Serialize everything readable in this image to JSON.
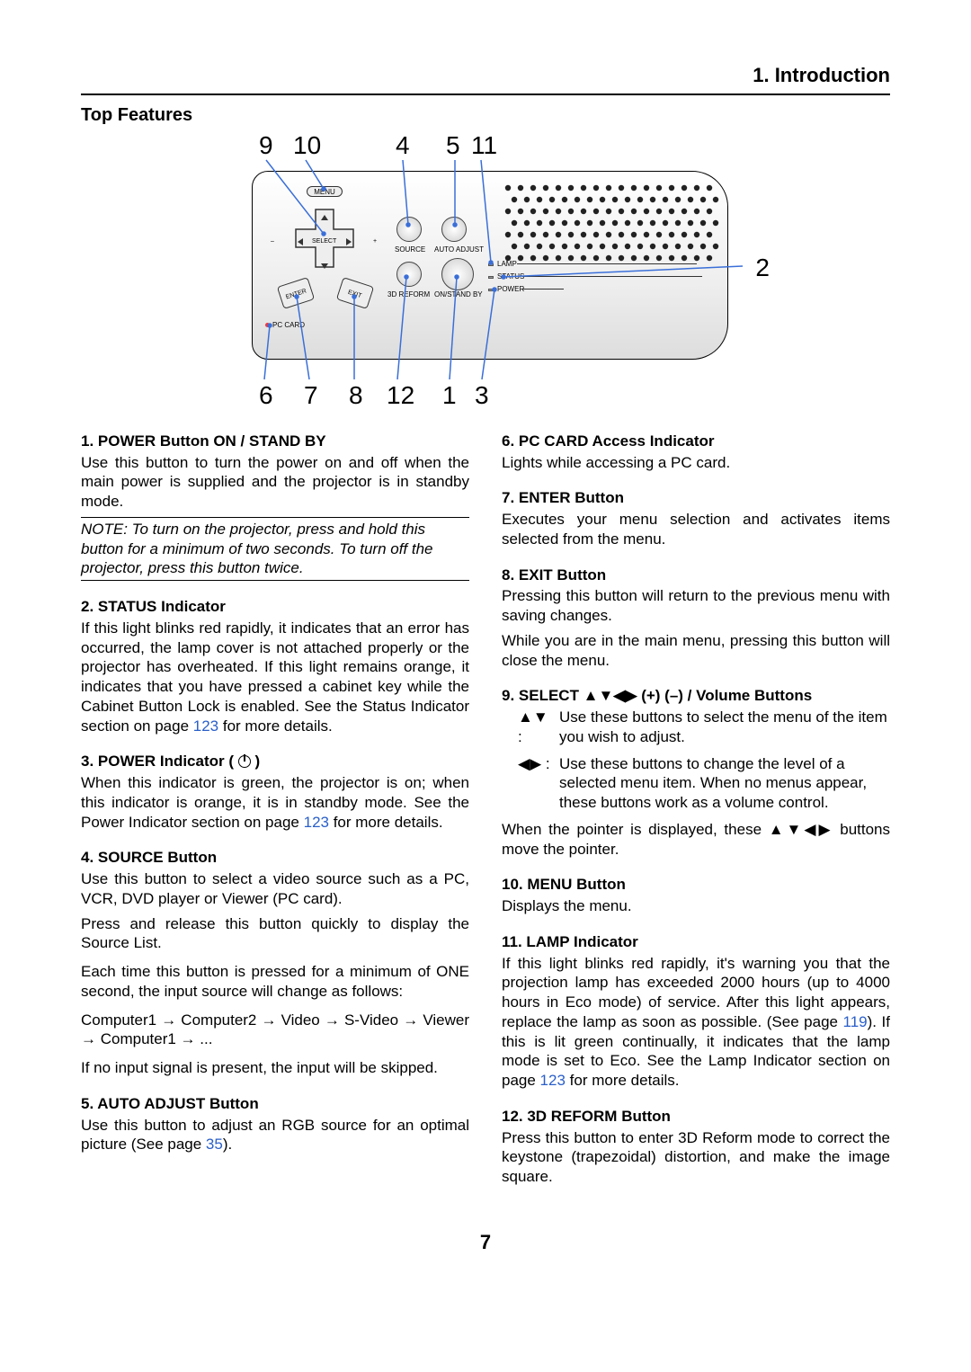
{
  "header": {
    "chapter": "1. Introduction"
  },
  "section_title": "Top Features",
  "diagram": {
    "top_numbers": {
      "n9": "9",
      "n10": "10",
      "n4": "4",
      "n5": "5",
      "n11": "11"
    },
    "side_number": "2",
    "bottom_numbers": {
      "n6": "6",
      "n7": "7",
      "n8": "8",
      "n12": "12",
      "n1": "1",
      "n3": "3"
    },
    "labels": {
      "menu": "MENU",
      "select": "SELECT",
      "enter": "ENTER",
      "exit": "EXIT",
      "source": "SOURCE",
      "auto_adjust": "AUTO ADJUST",
      "reform": "3D REFORM",
      "onstandby": "ON/STAND BY",
      "lamp": "LAMP",
      "status": "STATUS",
      "power": "POWER",
      "pc_card": "PC CARD",
      "plus": "+",
      "minus": "–"
    }
  },
  "left": {
    "i1": {
      "t": "1. POWER Button ON / STAND BY",
      "p": "Use this button to turn the power on and off when the main power is supplied and the projector is in standby mode.",
      "note": "NOTE: To turn on the projector, press and hold this button for a minimum of two seconds. To turn off the projector, press this button twice."
    },
    "i2": {
      "t": "2. STATUS Indicator",
      "p": "If this light blinks red rapidly, it indicates that an error has occurred, the lamp cover is not attached properly or the projector has overheated. If this light remains orange, it indicates that you have pressed a cabinet key while the Cabinet Button Lock is enabled. See the Status Indicator section on page ",
      "link": "123",
      "p2": " for more details."
    },
    "i3": {
      "t_a": "3. POWER Indicator ( ",
      "t_b": " )",
      "p": "When this indicator is green, the projector is on; when this indicator is orange, it is in standby mode. See the Power Indicator section on page ",
      "link": "123",
      "p2": " for more details."
    },
    "i4": {
      "t": "4. SOURCE Button",
      "p1": "Use this button to select a video source such as a PC, VCR, DVD player or Viewer (PC card).",
      "p2": "Press and release this button quickly to display the Source List.",
      "p3": "Each time this button is pressed for a minimum of ONE second, the input source will change as follows:",
      "seq": "Computer1 → Computer2 → Video → S-Video → Viewer → Computer1 → ...",
      "p4": "If no input signal is present, the input will be skipped."
    },
    "i5": {
      "t": "5. AUTO ADJUST Button",
      "p": "Use this button to adjust an RGB source for an optimal picture (See page ",
      "link": "35",
      "p2": ")."
    }
  },
  "right": {
    "i6": {
      "t": "6. PC CARD Access Indicator",
      "p": "Lights while accessing a PC card."
    },
    "i7": {
      "t": "7. ENTER Button",
      "p": "Executes your menu selection and activates items selected from the menu."
    },
    "i8": {
      "t": "8. EXIT Button",
      "p1": "Pressing this button will return to the previous menu with saving changes.",
      "p2": "While you are in the main menu, pressing this button will close the menu."
    },
    "i9": {
      "t": "9. SELECT ▲▼◀▶ (+) (–) / Volume Buttons",
      "row1_sym": "▲▼ :",
      "row1_txt": "Use these buttons to select the menu of the item you wish to adjust.",
      "row2_sym": "◀▶ :",
      "row2_txt": "Use these buttons to change the level of a selected menu item. When no menus appear, these buttons work as a volume control.",
      "p_after": "When the pointer is displayed, these ▲▼◀▶ buttons move the pointer."
    },
    "i10": {
      "t": "10. MENU Button",
      "p": "Displays the menu."
    },
    "i11": {
      "t": "11. LAMP Indicator",
      "p": "If this light blinks red rapidly, it's warning you that the projection lamp has exceeded 2000 hours (up to 4000 hours in Eco mode) of service. After this light appears, replace the lamp as soon as possible. (See page ",
      "link1": "119",
      "pmid": "). If this is lit green continually, it indicates that the lamp mode is set to Eco. See the Lamp Indicator section on page ",
      "link2": "123",
      "p2": " for more details."
    },
    "i12": {
      "t": "12. 3D REFORM Button",
      "p": "Press this button to enter 3D Reform mode to correct the keystone (trapezoidal) distortion, and make the image square."
    }
  },
  "page_number": "7"
}
